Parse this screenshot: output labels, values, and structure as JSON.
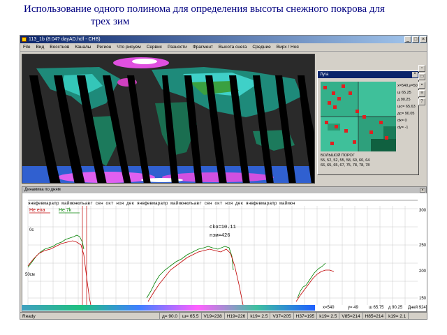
{
  "slide": {
    "title_line1": "Использование одного полинома для определения высоты снежного покрова для",
    "title_line2": "трех зим"
  },
  "window": {
    "title": "113_1b  (8:04?  dayAD.hdf - CHB)",
    "menu": [
      "File",
      "Вид",
      "Восстнов",
      "Каналы",
      "Регион",
      "Что рисуем",
      "Сервис",
      "Разности",
      "Фрагмент",
      "Высота снега",
      "Средние",
      "Вирх / Ноя"
    ]
  },
  "luga": {
    "title": "Луга",
    "params": [
      "x=540,y=50",
      "ш 65.25",
      "д 90.25",
      "шс= 65.63",
      "дс= 90.05",
      "dx= 0",
      "dy= -1"
    ],
    "threshold_label": "БОЛЬШОЙ ПОРОГ",
    "threshold_row1": "55, 52, 52, 55, 58, 60, 60, 64",
    "threshold_row2": "66, 65, 65, 67, 75, 78, 78, 78"
  },
  "dynamics": {
    "title": "Динамика по дням",
    "months_label": "янвфевмарапр майиюнюльавг сен окт ноя дек янвфевмарапр майиюнюльавг сен окт ноя дек янвфевмарапр майиюн",
    "legend_ne_ela": "Не ела",
    "legend_ne_7k": "Не 7k",
    "cko": "cko=10.11",
    "nzm": "нзм=426",
    "y_left_top": "0c",
    "y_left_bottom": "50см",
    "y_right": [
      "300",
      "250",
      "200",
      "150"
    ],
    "readout_x": "x=540",
    "readout_y": "y= 49",
    "readout_sh": "ш 65.75",
    "readout_d": "д 90.25",
    "readout_day": "Дней 924"
  },
  "status": {
    "ready": "Ready",
    "fields": [
      "д= 90.0",
      "ш= 65.5",
      "V19=238",
      "H19=226",
      "k19= 2.5",
      "V37=205",
      "H37=195",
      "k19= 2.5",
      "V85=214",
      "H85=214",
      "k19= 2.1"
    ]
  },
  "chart_data": {
    "type": "line",
    "xlabel": "",
    "ylabel": "",
    "ylim": [
      150,
      300
    ],
    "series": [
      {
        "name": "Не ела",
        "values": []
      },
      {
        "name": "Не 7k",
        "values": []
      }
    ]
  }
}
